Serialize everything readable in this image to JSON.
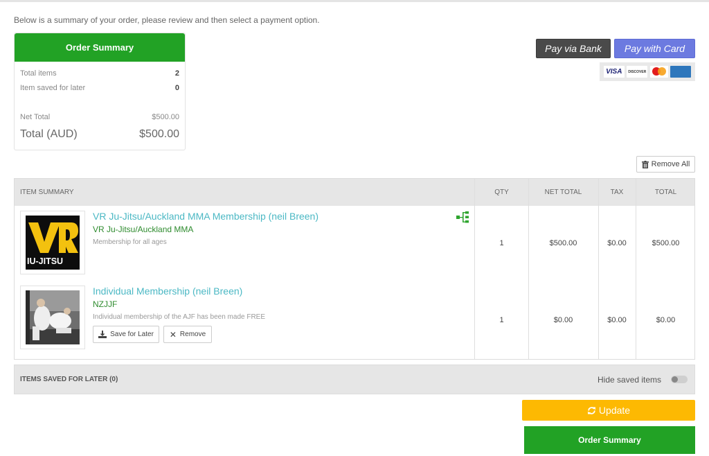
{
  "intro_text": "Below is a summary of your order, please review and then select a payment option.",
  "summary": {
    "title": "Order Summary",
    "total_items_label": "Total items",
    "total_items_value": "2",
    "saved_label": "Item saved for later",
    "saved_value": "0",
    "net_total_label": "Net Total",
    "net_total_value": "$500.00",
    "total_label": "Total (AUD)",
    "total_value": "$500.00"
  },
  "payment": {
    "bank_label": "Pay via Bank",
    "card_label": "Pay with Card",
    "card_logos": [
      "VISA",
      "DISCOVER",
      "MasterCard",
      "AMERICAN EXPRESS"
    ]
  },
  "remove_all_label": "Remove All",
  "table": {
    "headers": [
      "ITEM SUMMARY",
      "QTY",
      "NET TOTAL",
      "TAX",
      "TOTAL"
    ],
    "rows": [
      {
        "title": "VR Ju-Jitsu/Auckland MMA Membership (neil Breen)",
        "subtitle": "VR Ju-Jitsu/Auckland MMA",
        "description": "Membership for all ages",
        "thumb_text": "IU-JITSU",
        "qty": "1",
        "net_total": "$500.00",
        "tax": "$0.00",
        "total": "$500.00",
        "icon": "hierarchy-icon"
      },
      {
        "title": "Individual Membership (neil Breen)",
        "subtitle": "NZJJF",
        "description": "Individual membership of the AJF has been made FREE",
        "qty": "1",
        "net_total": "$0.00",
        "tax": "$0.00",
        "total": "$0.00",
        "save_label": "Save for Later",
        "remove_label": "Remove"
      }
    ]
  },
  "saved_section": {
    "label": "ITEMS SAVED FOR LATER (0)",
    "hide_label": "Hide saved items"
  },
  "update_label": "Update",
  "order_summary_button": "Order Summary",
  "colors": {
    "green": "#22a225",
    "bank": "#4a4a4a",
    "card": "#6c7ae0",
    "update": "#fdb902",
    "link": "#4bb8c4"
  }
}
